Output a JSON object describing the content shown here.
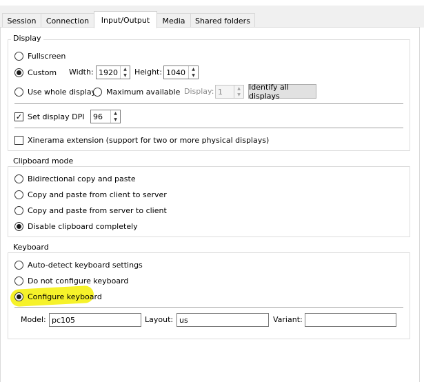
{
  "tabs": [
    {
      "label": "Session",
      "active": false
    },
    {
      "label": "Connection",
      "active": false
    },
    {
      "label": "Input/Output",
      "active": true
    },
    {
      "label": "Media",
      "active": false
    },
    {
      "label": "Shared folders",
      "active": false
    }
  ],
  "display": {
    "title": "Display",
    "fullscreen_label": "Fullscreen",
    "custom_label": "Custom",
    "width_label": "Width:",
    "width_value": "1920",
    "height_label": "Height:",
    "height_value": "1040",
    "whole_display_label": "Use whole display",
    "maximum_available_label": "Maximum available",
    "display_label": "Display:",
    "display_value": "1",
    "identify_button": "Identify all displays",
    "set_dpi_label": "Set display DPI",
    "dpi_value": "96",
    "xinerama_label": "Xinerama extension (support for two or more physical displays)",
    "selected": "custom",
    "set_dpi_checked": true,
    "xinerama_checked": false
  },
  "clipboard": {
    "title": "Clipboard mode",
    "options": [
      "Bidirectional copy and paste",
      "Copy and paste from client to server",
      "Copy and paste from server to client",
      "Disable clipboard completely"
    ],
    "selected_index": 3
  },
  "keyboard": {
    "title": "Keyboard",
    "options": [
      "Auto-detect keyboard settings",
      "Do not configure keyboard",
      "Configure keyboard"
    ],
    "selected_index": 2,
    "model_label": "Model:",
    "model_value": "pc105",
    "layout_label": "Layout:",
    "layout_value": "us",
    "variant_label": "Variant:",
    "variant_value": ""
  },
  "colors": {
    "highlight": "#f6f22a"
  }
}
